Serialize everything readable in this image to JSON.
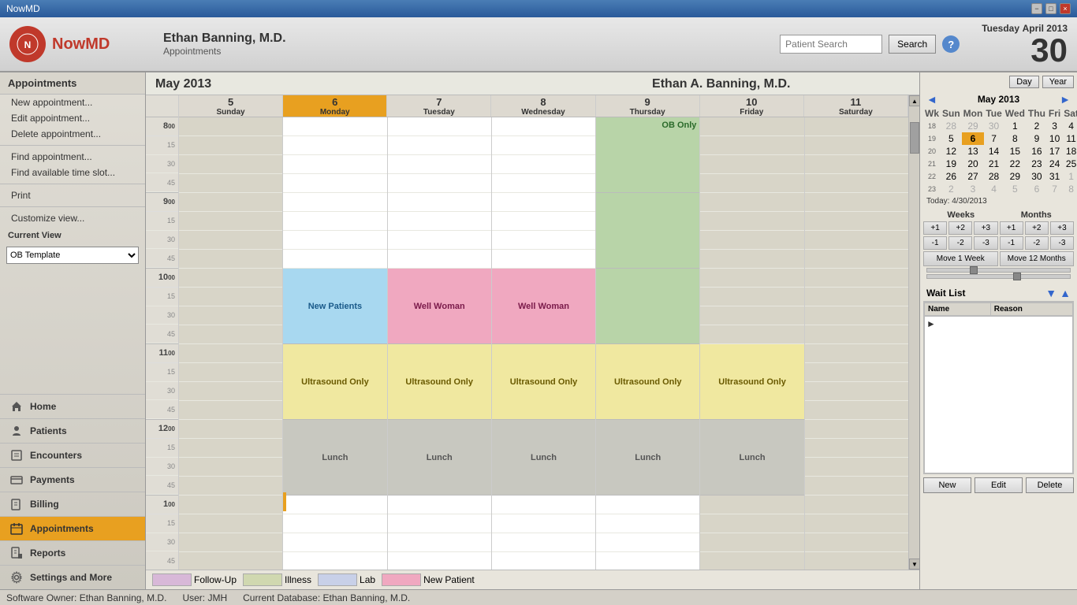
{
  "titlebar": {
    "title": "NowMD",
    "min_btn": "−",
    "max_btn": "□",
    "close_btn": "×"
  },
  "header": {
    "logo_initial": "N",
    "logo_text": "NowMD",
    "doctor_name": "Ethan Banning, M.D.",
    "breadcrumb": "Appointments",
    "search_placeholder": "Patient Search",
    "search_btn": "Search",
    "help_btn": "?",
    "date_label": "April 2013",
    "date_day": "30",
    "date_weekday": "Tuesday"
  },
  "sidebar": {
    "section_title": "Appointments",
    "menu_items": [
      "New appointment...",
      "Edit appointment...",
      "Delete appointment...",
      "Find appointment...",
      "Find available time slot...",
      "Print",
      "Customize view..."
    ],
    "current_view_label": "Current View",
    "current_view_value": "OB Template",
    "nav_items": [
      {
        "label": "Home",
        "icon": "home"
      },
      {
        "label": "Patients",
        "icon": "patients"
      },
      {
        "label": "Encounters",
        "icon": "encounters"
      },
      {
        "label": "Payments",
        "icon": "payments"
      },
      {
        "label": "Billing",
        "icon": "billing"
      },
      {
        "label": "Appointments",
        "icon": "appointments",
        "active": true
      },
      {
        "label": "Reports",
        "icon": "reports"
      },
      {
        "label": "Settings and More",
        "icon": "settings"
      }
    ]
  },
  "calendar": {
    "month_title": "May 2013",
    "doctor_title": "Ethan A. Banning, M.D.",
    "days": [
      {
        "num": "5",
        "name": "Sunday"
      },
      {
        "num": "6",
        "name": "Monday",
        "today": true
      },
      {
        "num": "7",
        "name": "Tuesday"
      },
      {
        "num": "8",
        "name": "Wednesday"
      },
      {
        "num": "9",
        "name": "Thursday"
      },
      {
        "num": "10",
        "name": "Friday"
      },
      {
        "num": "11",
        "name": "Saturday"
      }
    ],
    "time_slots": [
      {
        "hour": "8",
        "label": "8 00",
        "quarters": [
          "15",
          "30",
          "45"
        ]
      },
      {
        "hour": "9",
        "label": "9 00",
        "quarters": [
          "15",
          "30",
          "45"
        ]
      },
      {
        "hour": "10",
        "label": "10 00",
        "quarters": [
          "15",
          "30",
          "45"
        ]
      },
      {
        "hour": "11",
        "label": "11 00",
        "quarters": [
          "15",
          "30",
          "45"
        ]
      },
      {
        "hour": "12",
        "label": "12 00",
        "quarters": [
          "15",
          "30",
          "45"
        ]
      },
      {
        "hour": "1",
        "label": "1 00",
        "quarters": [
          "15",
          "30",
          "45"
        ]
      }
    ],
    "appointments": {
      "thursday_ob": "OB Only",
      "monday_new_patients": "New Patients",
      "tuesday_well_woman": "Well Woman",
      "wednesday_well_woman": "Well Woman",
      "monday_ultrasound": "Ultrasound Only",
      "tuesday_ultrasound": "Ultrasound Only",
      "wednesday_ultrasound": "Ultrasound Only",
      "thursday_ultrasound": "Ultrasound Only",
      "friday_ultrasound": "Ultrasound Only",
      "monday_lunch": "Lunch",
      "tuesday_lunch": "Lunch",
      "wednesday_lunch": "Lunch",
      "thursday_lunch": "Lunch",
      "friday_lunch": "Lunch"
    }
  },
  "mini_calendar": {
    "month_year": "May 2013",
    "prev_btn": "◄",
    "next_btn": "►",
    "day_headers": [
      "Wk",
      "Sun",
      "Mon",
      "Tue",
      "Wed",
      "Thu",
      "Fri",
      "Sat"
    ],
    "weeks": [
      {
        "wk": "18",
        "days": [
          "28",
          "29",
          "30",
          "1",
          "2",
          "3",
          "4"
        ],
        "prev": [
          true,
          true,
          true,
          false,
          false,
          false,
          false
        ]
      },
      {
        "wk": "19",
        "days": [
          "5",
          "6",
          "7",
          "8",
          "9",
          "10",
          "11"
        ],
        "today_idx": 1
      },
      {
        "wk": "20",
        "days": [
          "12",
          "13",
          "14",
          "15",
          "16",
          "17",
          "18"
        ]
      },
      {
        "wk": "21",
        "days": [
          "19",
          "20",
          "21",
          "22",
          "23",
          "24",
          "25"
        ]
      },
      {
        "wk": "22",
        "days": [
          "26",
          "27",
          "28",
          "29",
          "30",
          "31",
          "1"
        ],
        "next": [
          false,
          false,
          false,
          false,
          false,
          false,
          true
        ]
      },
      {
        "wk": "23",
        "days": [
          "2",
          "3",
          "4",
          "5",
          "6",
          "7",
          "8"
        ],
        "all_next": true
      }
    ],
    "day_year_btns": [
      "Day",
      "Year"
    ],
    "today_label": "Today: 4/30/2013"
  },
  "week_month_nav": {
    "weeks_label": "Weeks",
    "months_label": "Months",
    "plus_btns": [
      "+1",
      "+2",
      "+3",
      "+1",
      "+2",
      "+3"
    ],
    "minus_btns": [
      "-1",
      "-2",
      "-3",
      "-1",
      "-2",
      "-3"
    ],
    "move_week_btn": "Move 1 Week",
    "move_months_btn": "Move 12 Months"
  },
  "wait_list": {
    "title": "Wait List",
    "col_name": "Name",
    "col_reason": "Reason",
    "down_arrow": "▼",
    "up_arrow": "▲",
    "arrow_right": "►"
  },
  "wait_list_btns": {
    "new_btn": "New",
    "edit_btn": "Edit",
    "delete_btn": "Delete"
  },
  "legend": [
    {
      "label": "Follow-Up",
      "color": "#d8b8d8"
    },
    {
      "label": "Illness",
      "color": "#d0d8b0"
    },
    {
      "label": "Lab",
      "color": "#c8d0e8"
    },
    {
      "label": "New Patient",
      "color": "#f0a8c0"
    }
  ],
  "status_bar": {
    "software_owner": "Software Owner: Ethan Banning, M.D.",
    "user": "User: JMH",
    "database": "Current Database: Ethan Banning, M.D."
  }
}
